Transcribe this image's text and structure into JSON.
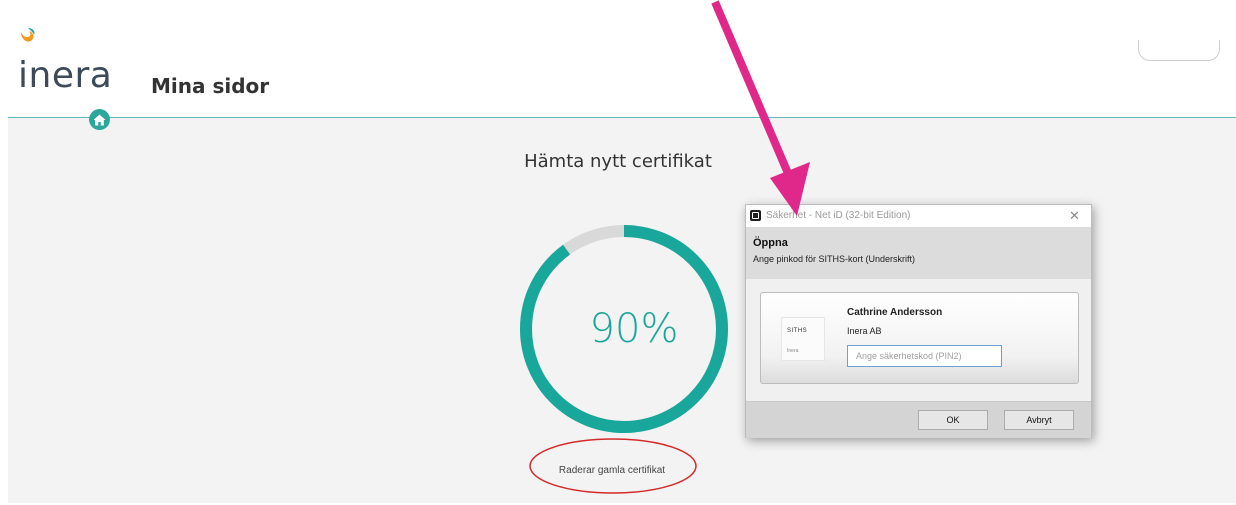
{
  "header": {
    "logo_text": "inera",
    "site_title": "Mina sidor",
    "home_icon": "home-icon"
  },
  "page": {
    "heading": "Hämta nytt certifikat",
    "progress_label": "90%",
    "progress_value": 0.9,
    "status_text": "Raderar gamla certifikat"
  },
  "dialog": {
    "title": "Säkerhet - Net iD (32-bit Edition)",
    "close_label": "✕",
    "header_title": "Öppna",
    "header_subtitle": "Ange pinkod för SITHS-kort (Underskrift)",
    "card_logo_top": "SITHS",
    "card_logo_bottom": "Inera",
    "user_name": "Cathrine Andersson",
    "organization": "Inera AB",
    "pin_placeholder": "Ange säkerhetskod (PIN2)",
    "ok_label": "OK",
    "cancel_label": "Avbryt"
  },
  "colors": {
    "accent": "#1aa79b",
    "annotation_arrow": "#e0288a",
    "annotation_ellipse": "#d42a2a"
  }
}
